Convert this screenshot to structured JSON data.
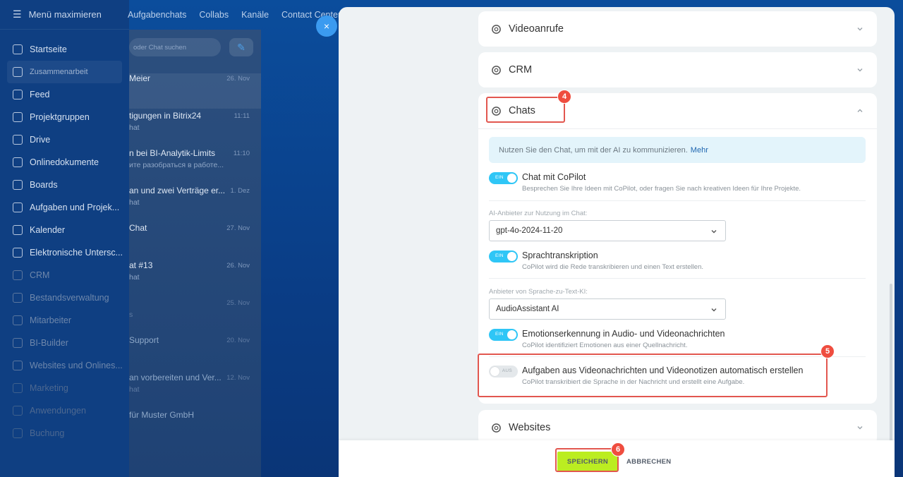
{
  "background": {
    "menu_toggle": "Menü maximieren",
    "menu_items": [
      {
        "label": "Startseite",
        "style": ""
      },
      {
        "label": "Zusammenarbeit",
        "style": "group"
      },
      {
        "label": "Feed",
        "style": ""
      },
      {
        "label": "Projektgruppen",
        "style": ""
      },
      {
        "label": "Drive",
        "style": ""
      },
      {
        "label": "Onlinedokumente",
        "style": ""
      },
      {
        "label": "Boards",
        "style": ""
      },
      {
        "label": "Aufgaben und Projek...",
        "style": ""
      },
      {
        "label": "Kalender",
        "style": ""
      },
      {
        "label": "Elektronische Untersc...",
        "style": ""
      },
      {
        "label": "CRM",
        "style": "dim"
      },
      {
        "label": "Bestandsverwaltung",
        "style": "dim"
      },
      {
        "label": "Mitarbeiter",
        "style": "dim"
      },
      {
        "label": "BI-Builder",
        "style": "dim"
      },
      {
        "label": "Websites und Onlines...",
        "style": "dim"
      },
      {
        "label": "Marketing",
        "style": "dimmer"
      },
      {
        "label": "Anwendungen",
        "style": "dimmer"
      },
      {
        "label": "Buchung",
        "style": "dimmer"
      }
    ],
    "top_tabs": [
      "Aufgabenchats",
      "Collabs",
      "Kanäle",
      "Contact Center"
    ],
    "chat_search_placeholder": "oder Chat suchen",
    "chats": [
      {
        "title": "Meier",
        "sub": "",
        "date": "26. Nov",
        "style": "highlight"
      },
      {
        "title": "tigungen in Bitrix24",
        "sub": "hat",
        "date": "11:11",
        "style": ""
      },
      {
        "title": "n bei BI-Analytik-Limits",
        "sub": "ите разобраться в работе...",
        "date": "11:10",
        "style": ""
      },
      {
        "title": "an und zwei Verträge er...",
        "sub": "hat",
        "date": "1. Dez",
        "style": ""
      },
      {
        "title": "Chat",
        "sub": "",
        "date": "27. Nov",
        "style": ""
      },
      {
        "title": "at #13",
        "sub": "hat",
        "date": "26. Nov",
        "style": ""
      },
      {
        "title": "",
        "sub": "s",
        "date": "25. Nov",
        "style": "dim"
      },
      {
        "title": "Support",
        "sub": "",
        "date": "20. Nov",
        "style": "dim"
      },
      {
        "title": "an vorbereiten und Ver...",
        "sub": "hat",
        "date": "12. Nov",
        "style": "dim"
      },
      {
        "title": "für Muster GmbH",
        "sub": "",
        "date": "",
        "style": "dim"
      }
    ]
  },
  "close_label": "×",
  "sections": {
    "videoanrufe": "Videoanrufe",
    "crm": "CRM",
    "chats": "Chats",
    "websites": "Websites"
  },
  "chats_section": {
    "info_text": "Nutzen Sie den Chat, um mit der AI zu kommunizieren.",
    "info_link": "Mehr",
    "toggle_on_label": "EIN",
    "toggle_off_label": "AUS",
    "opt_copilot_title": "Chat mit CoPilot",
    "opt_copilot_desc": "Besprechen Sie Ihre Ideen mit CoPilot, oder fragen Sie nach kreativen Ideen für Ihre Projekte.",
    "provider_label": "AI-Anbieter zur Nutzung im Chat:",
    "provider_value": "gpt-4o-2024-11-20",
    "opt_speech_title": "Sprachtranskription",
    "opt_speech_desc": "CoPilot wird die Rede transkribieren und einen Text erstellen.",
    "stt_label": "Anbieter von Sprache-zu-Text-KI:",
    "stt_value": "AudioAssistant AI",
    "opt_emotion_title": "Emotionserkennung in Audio- und Videonachrichten",
    "opt_emotion_desc": "CoPilot identifiziert Emotionen aus einer Quellnachricht.",
    "opt_tasks_title": "Aufgaben aus Videonachrichten und Videonotizen automatisch erstellen",
    "opt_tasks_desc": "CoPilot transkribiert die Sprache in der Nachricht und erstellt eine Aufgabe."
  },
  "footer": {
    "save_label": "SPEICHERN",
    "cancel_label": "ABBRECHEN"
  },
  "annotations": {
    "badge_chats": "4",
    "badge_tasks": "5",
    "badge_save": "6"
  },
  "colors": {
    "accent_toggle": "#2fc6f6",
    "save_button": "#bbed21",
    "annotation_red": "#e2574f"
  }
}
